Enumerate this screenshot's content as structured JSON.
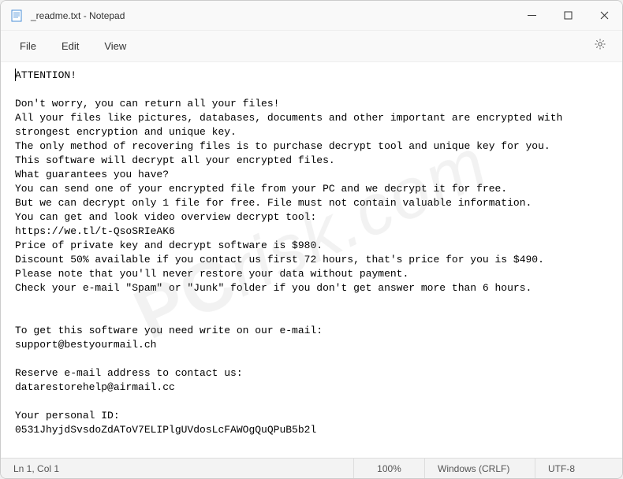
{
  "window": {
    "title": "_readme.txt - Notepad"
  },
  "menu": {
    "file": "File",
    "edit": "Edit",
    "view": "View"
  },
  "content": {
    "text": "ATTENTION!\n\nDon't worry, you can return all your files!\nAll your files like pictures, databases, documents and other important are encrypted with strongest encryption and unique key.\nThe only method of recovering files is to purchase decrypt tool and unique key for you.\nThis software will decrypt all your encrypted files.\nWhat guarantees you have?\nYou can send one of your encrypted file from your PC and we decrypt it for free.\nBut we can decrypt only 1 file for free. File must not contain valuable information.\nYou can get and look video overview decrypt tool:\nhttps://we.tl/t-QsoSRIeAK6\nPrice of private key and decrypt software is $980.\nDiscount 50% available if you contact us first 72 hours, that's price for you is $490.\nPlease note that you'll never restore your data without payment.\nCheck your e-mail \"Spam\" or \"Junk\" folder if you don't get answer more than 6 hours.\n\n\nTo get this software you need write on our e-mail:\nsupport@bestyourmail.ch\n\nReserve e-mail address to contact us:\ndatarestorehelp@airmail.cc\n\nYour personal ID:\n0531JhyjdSvsdoZdAToV7ELIPlgUVdosLcFAWOgQuQPuB5b2l"
  },
  "statusbar": {
    "position": "Ln 1, Col 1",
    "zoom": "100%",
    "lineending": "Windows (CRLF)",
    "encoding": "UTF-8"
  },
  "watermark": {
    "text1": "PC",
    "text2": "risk.com"
  }
}
